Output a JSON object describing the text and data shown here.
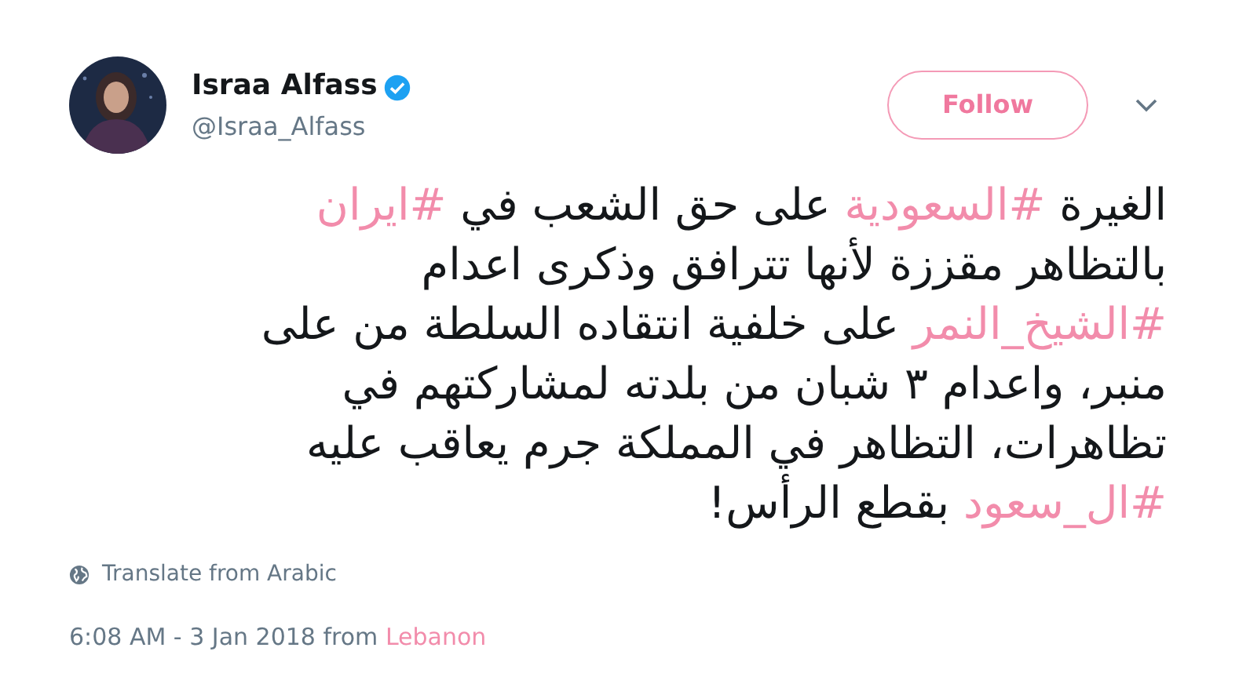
{
  "author": {
    "name": "Israa Alfass",
    "verified": true,
    "handle": "@Israa_Alfass"
  },
  "follow_button": {
    "label": "Follow"
  },
  "tweet_text": [
    {
      "kind": "text",
      "text": "الغيرة "
    },
    {
      "kind": "hashtag",
      "text": "#السعودية"
    },
    {
      "kind": "text",
      "text": " على حق الشعب في "
    },
    {
      "kind": "hashtag",
      "text": "#ايران"
    },
    {
      "kind": "text",
      "text": " بالتظاهر مقززة لأنها تترافق وذكرى اعدام "
    },
    {
      "kind": "hashtag",
      "text": "#الشيخ_النمر"
    },
    {
      "kind": "text",
      "text": " على خلفية انتقاده السلطة من على منبر، واعدام ٣ شبان من بلدته لمشاركتهم في تظاهرات، التظاهر في المملكة جرم يعاقب عليه "
    },
    {
      "kind": "hashtag",
      "text": "#ال_سعود"
    },
    {
      "kind": "text",
      "text": " بقطع الرأس!"
    }
  ],
  "translate_link": "Translate from Arabic",
  "timestamp": {
    "time": "6:08 AM - 3 Jan 2018 from ",
    "location": "Lebanon"
  }
}
